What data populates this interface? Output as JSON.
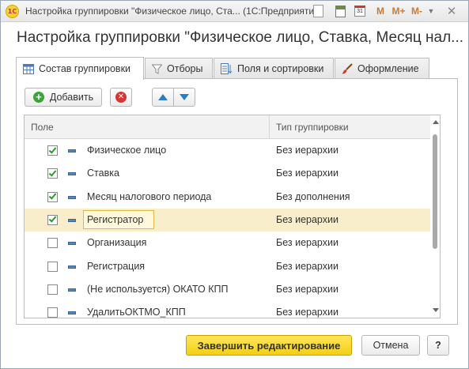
{
  "window": {
    "logo_text": "1С",
    "title": "Настройка группировки \"Физическое лицо, Ста...  (1С:Предприятие)",
    "toolbar": {
      "calendar_label": "31",
      "m_label": "M",
      "m_plus_label": "M+",
      "m_minus_label": "M-",
      "menu_glyph": "▼",
      "close_glyph": "✕"
    }
  },
  "page": {
    "title": "Настройка группировки \"Физическое лицо, Ставка, Месяц нал..."
  },
  "tabs": [
    {
      "label": "Состав группировки",
      "active": true,
      "icon": "table-icon"
    },
    {
      "label": "Отборы",
      "active": false,
      "icon": "filter-icon"
    },
    {
      "label": "Поля и сортировки",
      "active": false,
      "icon": "fields-sort-icon"
    },
    {
      "label": "Оформление",
      "active": false,
      "icon": "brush-icon"
    }
  ],
  "toolbar": {
    "add_label": "Добавить"
  },
  "table": {
    "columns": [
      "Поле",
      "Тип группировки"
    ],
    "rows": [
      {
        "checked": true,
        "field": "Физическое лицо",
        "type": "Без иерархии",
        "selected": false
      },
      {
        "checked": true,
        "field": "Ставка",
        "type": "Без иерархии",
        "selected": false
      },
      {
        "checked": true,
        "field": "Месяц налогового периода",
        "type": "Без дополнения",
        "selected": false
      },
      {
        "checked": true,
        "field": "Регистратор",
        "type": "Без иерархии",
        "selected": true
      },
      {
        "checked": false,
        "field": "Организация",
        "type": "Без иерархии",
        "selected": false
      },
      {
        "checked": false,
        "field": "Регистрация",
        "type": "Без иерархии",
        "selected": false
      },
      {
        "checked": false,
        "field": "(Не используется) ОКАТО КПП",
        "type": "Без иерархии",
        "selected": false
      },
      {
        "checked": false,
        "field": "УдалитьОКТМО_КПП",
        "type": "Без иерархии",
        "selected": false
      }
    ]
  },
  "footer": {
    "finish_label": "Завершить редактирование",
    "cancel_label": "Отмена",
    "help_label": "?"
  },
  "colors": {
    "accent_yellow": "#f3cf17",
    "selected_row": "#f9eecb",
    "check_green": "#2c9a2c",
    "arrow_blue": "#2a7cc7"
  }
}
